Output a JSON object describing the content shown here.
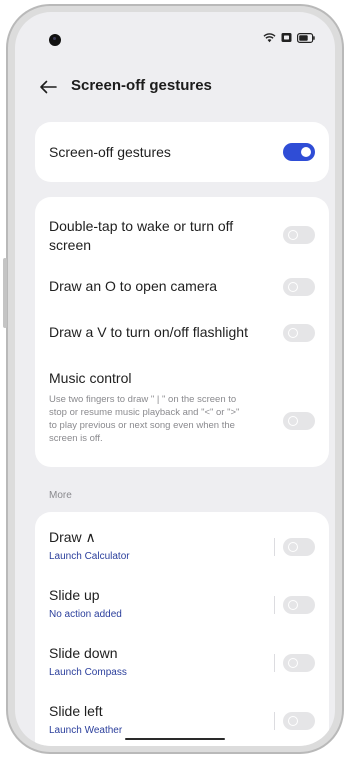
{
  "header": {
    "title": "Screen-off gestures"
  },
  "master": {
    "label": "Screen-off gestures",
    "enabled": true
  },
  "gestures": [
    {
      "title_line1": "Double-tap to wake or turn off",
      "title_line2": "screen",
      "enabled": false
    },
    {
      "title": "Draw an O to open camera",
      "enabled": false
    },
    {
      "title": "Draw a V to turn on/off flashlight",
      "enabled": false
    },
    {
      "title": "Music control",
      "desc_line1": "Use two fingers to draw \" | \" on the screen to",
      "desc_line2": "stop or resume music playback and \"<\" or \">\"",
      "desc_line3": "to play previous or next song even when the",
      "desc_line4": "screen is off.",
      "enabled": false
    }
  ],
  "more": {
    "label": "More",
    "items": [
      {
        "title": "Draw ∧",
        "action": "Launch Calculator",
        "enabled": false
      },
      {
        "title": "Slide up",
        "action": "No action added",
        "enabled": false
      },
      {
        "title": "Slide down",
        "action": "Launch Compass",
        "enabled": false
      },
      {
        "title": "Slide left",
        "action": "Launch Weather",
        "enabled": false
      }
    ]
  },
  "icons": {
    "back": "back-arrow-icon",
    "wifi": "wifi-icon",
    "sim": "sim-icon",
    "battery": "battery-icon"
  },
  "colors": {
    "accent": "#2f4dd6",
    "background": "#eeeef1",
    "card": "#ffffff",
    "link_text": "#2b3f9c"
  }
}
